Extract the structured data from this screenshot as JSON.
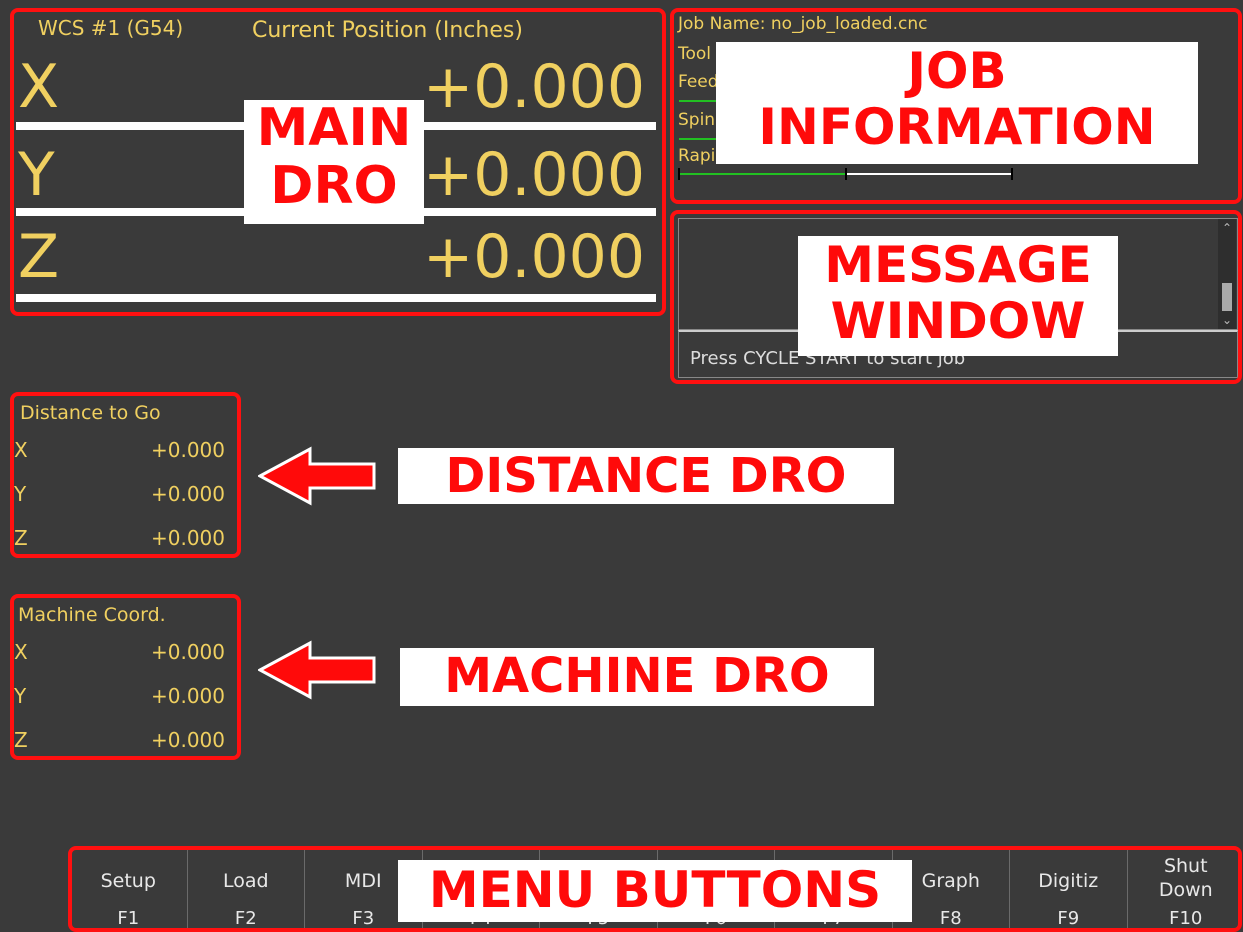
{
  "main_dro": {
    "wcs": "WCS #1 (G54)",
    "title": "Current Position (Inches)",
    "axes": [
      {
        "letter": "X",
        "value": "+0.000"
      },
      {
        "letter": "Y",
        "value": "+0.000"
      },
      {
        "letter": "Z",
        "value": "+0.000"
      }
    ]
  },
  "job": {
    "name": "Job Name: no_job_loaded.cnc",
    "tool_label": "Tool",
    "feed_label": "Feed",
    "spin_label": "Spin",
    "rapid_label": "Rapid Rate: 100%"
  },
  "message": {
    "text": "Press CYCLE START to start job"
  },
  "distance_dro": {
    "title": "Distance to Go",
    "axes": [
      {
        "letter": "X",
        "value": "+0.000"
      },
      {
        "letter": "Y",
        "value": "+0.000"
      },
      {
        "letter": "Z",
        "value": "+0.000"
      }
    ]
  },
  "machine_dro": {
    "title": "Machine Coord.",
    "axes": [
      {
        "letter": "X",
        "value": "+0.000"
      },
      {
        "letter": "Y",
        "value": "+0.000"
      },
      {
        "letter": "Z",
        "value": "+0.000"
      }
    ]
  },
  "menu": [
    {
      "label": "Setup",
      "key": "F1"
    },
    {
      "label": "Load",
      "key": "F2"
    },
    {
      "label": "MDI",
      "key": "F3"
    },
    {
      "label": "",
      "key": "F4"
    },
    {
      "label": "",
      "key": "F5"
    },
    {
      "label": "",
      "key": "F6"
    },
    {
      "label": "",
      "key": "F7"
    },
    {
      "label": "Graph",
      "key": "F8"
    },
    {
      "label": "Digitiz",
      "key": "F9"
    },
    {
      "label": "Shut Down",
      "key": "F10"
    }
  ],
  "annotations": {
    "main_dro": [
      "MAIN",
      "DRO"
    ],
    "job_info": [
      "JOB",
      "INFORMATION"
    ],
    "message_window": [
      "MESSAGE",
      "WINDOW"
    ],
    "distance_dro": "DISTANCE DRO",
    "machine_dro": "MACHINE DRO",
    "menu_buttons": "MENU BUTTONS"
  },
  "colors": {
    "background": "#3a3a3a",
    "dro_text": "#f0d060",
    "annotation": "#ff0a0a",
    "progress": "#22c022"
  }
}
